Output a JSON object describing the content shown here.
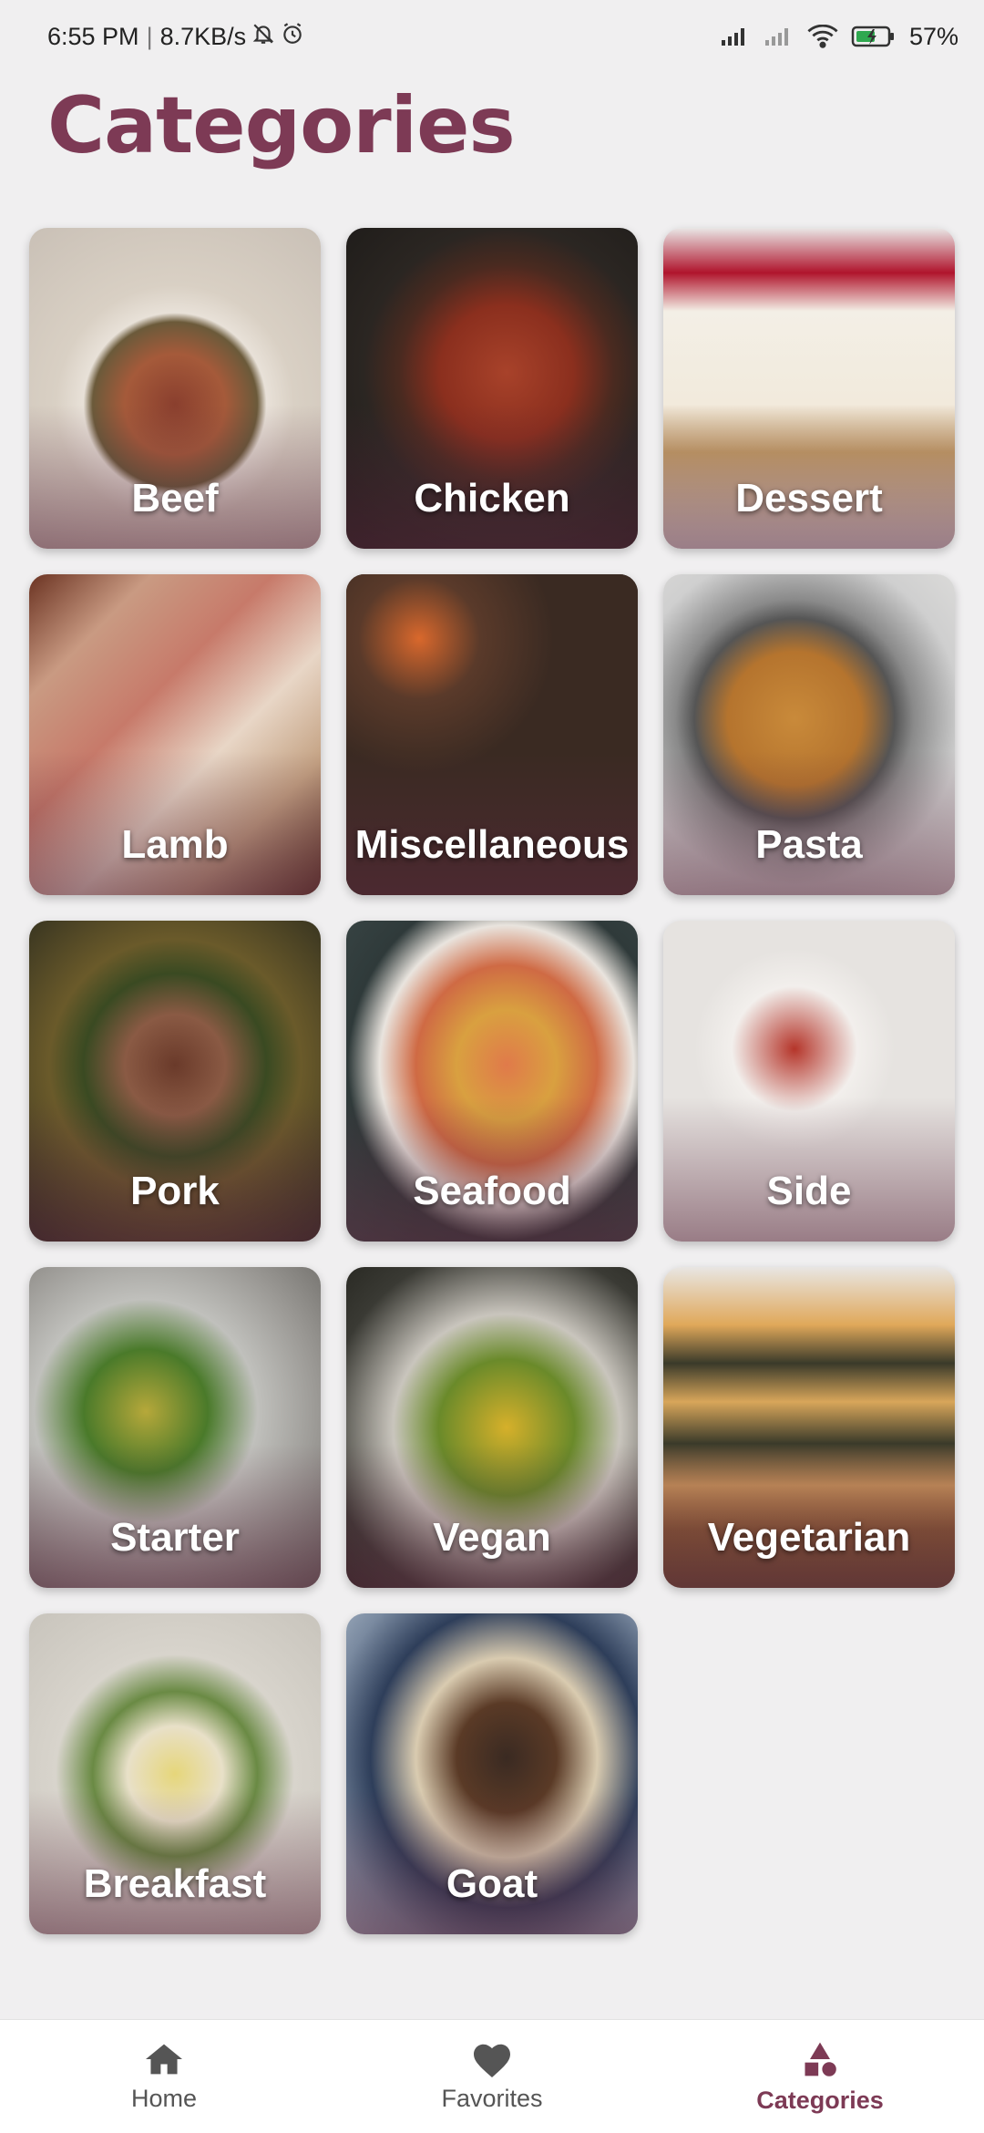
{
  "status": {
    "time": "6:55 PM",
    "speed": "8.7KB/s",
    "battery": "57%"
  },
  "header": {
    "title": "Categories"
  },
  "categories": [
    {
      "label": "Beef"
    },
    {
      "label": "Chicken"
    },
    {
      "label": "Dessert"
    },
    {
      "label": "Lamb"
    },
    {
      "label": "Miscellaneous"
    },
    {
      "label": "Pasta"
    },
    {
      "label": "Pork"
    },
    {
      "label": "Seafood"
    },
    {
      "label": "Side"
    },
    {
      "label": "Starter"
    },
    {
      "label": "Vegan"
    },
    {
      "label": "Vegetarian"
    },
    {
      "label": "Breakfast"
    },
    {
      "label": "Goat"
    }
  ],
  "nav": {
    "home": "Home",
    "favorites": "Favorites",
    "categories": "Categories",
    "active": "categories"
  },
  "colors": {
    "accent": "#7d3a55",
    "background": "#f0eff0"
  }
}
